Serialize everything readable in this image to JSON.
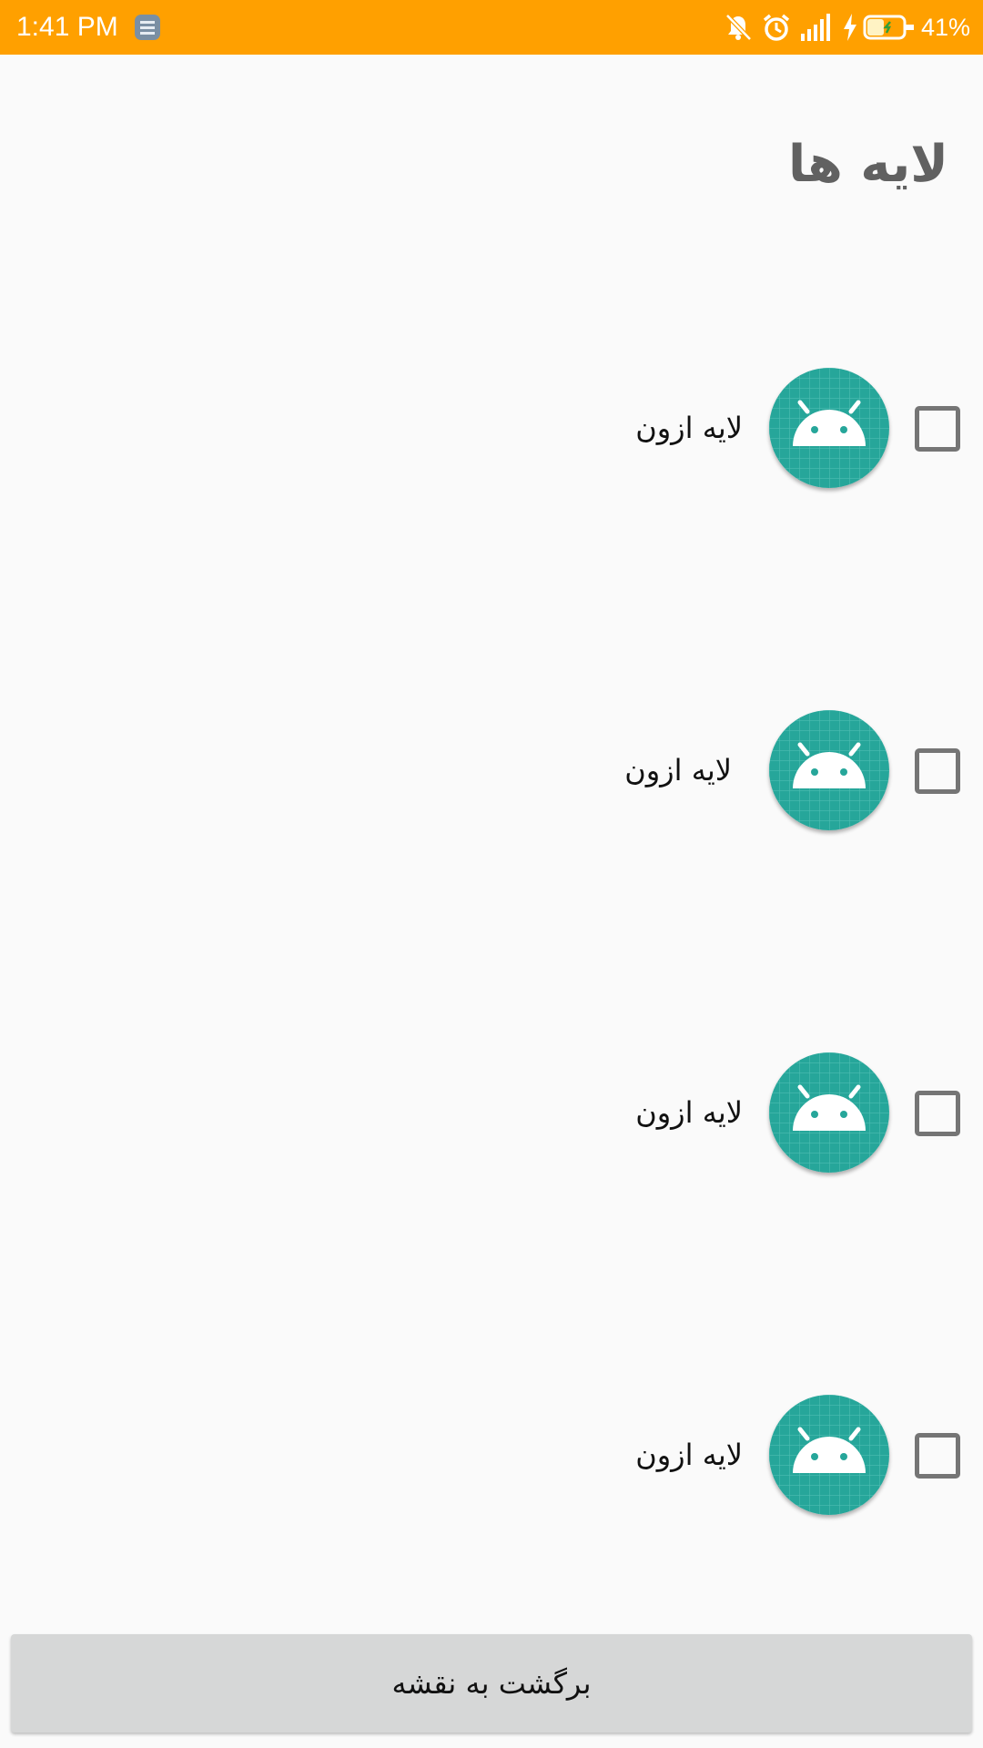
{
  "status_bar": {
    "time": "1:41 PM",
    "battery": "41%",
    "background": "#ffa000",
    "icons": [
      "app-notification-icon",
      "muted-bell-icon",
      "alarm-icon",
      "signal-icon",
      "charging-icon",
      "battery-icon"
    ]
  },
  "page": {
    "title": "لایه ها"
  },
  "layers": [
    {
      "label": "لایه ازون",
      "checked": false,
      "icon": "android-icon"
    },
    {
      "label": "لایه ازون",
      "checked": false,
      "icon": "android-icon"
    },
    {
      "label": "لایه ازون",
      "checked": false,
      "icon": "android-icon"
    },
    {
      "label": "لایه ازون",
      "checked": false,
      "icon": "android-icon"
    }
  ],
  "footer": {
    "back_button_label": "برگشت به نقشه"
  },
  "colors": {
    "accent": "#ffa000",
    "icon_bg": "#26a69a",
    "button_bg": "#d6d7d7"
  }
}
